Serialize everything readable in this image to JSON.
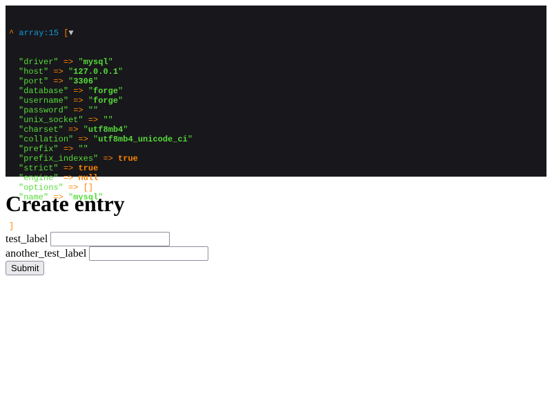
{
  "dump": {
    "caret": "^",
    "type_label": "array:15",
    "open_bracket": "[",
    "toggle": "▼",
    "close_bracket": "]",
    "arrow": "=>",
    "items": [
      {
        "key": "driver",
        "value": "mysql",
        "kind": "string"
      },
      {
        "key": "host",
        "value": "127.0.0.1",
        "kind": "string"
      },
      {
        "key": "port",
        "value": "3306",
        "kind": "string"
      },
      {
        "key": "database",
        "value": "forge",
        "kind": "string"
      },
      {
        "key": "username",
        "value": "forge",
        "kind": "string"
      },
      {
        "key": "password",
        "value": "",
        "kind": "string"
      },
      {
        "key": "unix_socket",
        "value": "",
        "kind": "string"
      },
      {
        "key": "charset",
        "value": "utf8mb4",
        "kind": "string"
      },
      {
        "key": "collation",
        "value": "utf8mb4_unicode_ci",
        "kind": "string"
      },
      {
        "key": "prefix",
        "value": "",
        "kind": "string"
      },
      {
        "key": "prefix_indexes",
        "value": "true",
        "kind": "bool"
      },
      {
        "key": "strict",
        "value": "true",
        "kind": "bool"
      },
      {
        "key": "engine",
        "value": "null",
        "kind": "bool"
      },
      {
        "key": "options",
        "value": "[]",
        "kind": "array"
      },
      {
        "key": "name",
        "value": "mysql",
        "kind": "string"
      }
    ]
  },
  "page": {
    "title": "Create entry"
  },
  "form": {
    "fields": [
      {
        "label": "test_label",
        "value": ""
      },
      {
        "label": "another_test_label",
        "value": ""
      }
    ],
    "submit_label": "Submit"
  }
}
